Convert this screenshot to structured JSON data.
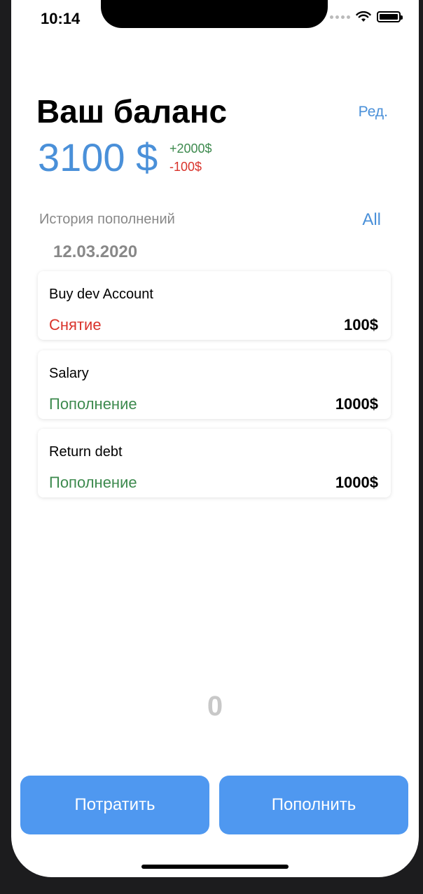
{
  "status_bar": {
    "time": "10:14",
    "icons": [
      "signal-dots-icon",
      "wifi-icon",
      "battery-icon"
    ]
  },
  "header": {
    "title": "Ваш баланс",
    "edit_label": "Ред.",
    "balance": "3100 $",
    "delta_plus": "+2000$",
    "delta_minus": "-100$"
  },
  "history": {
    "label": "История пополнений",
    "all_label": "All",
    "date": "12.03.2020",
    "items": [
      {
        "name": "Buy dev Account",
        "type": "Снятие",
        "amount": "100$"
      },
      {
        "name": "Salary",
        "type": "Пополнение",
        "amount": "1000$"
      },
      {
        "name": "Return debt",
        "type": "Пополнение",
        "amount": "1000$"
      }
    ]
  },
  "counter": "0",
  "actions": {
    "spend_label": "Потратить",
    "topup_label": "Пополнить"
  },
  "colors": {
    "accent": "#4a90d9",
    "button": "#4f98f0",
    "income": "#3d8a4e",
    "expense": "#d9332b"
  }
}
